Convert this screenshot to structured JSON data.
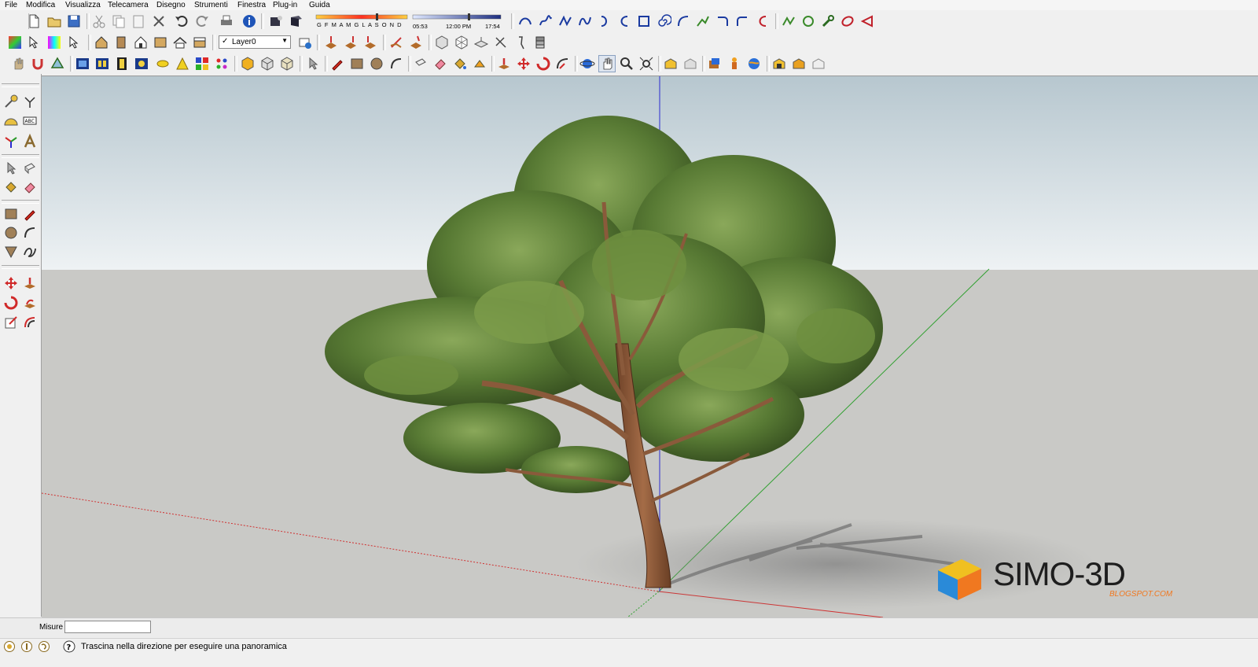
{
  "menu": [
    "File",
    "Modifica",
    "Visualizza",
    "Telecamera",
    "Disegno",
    "Strumenti",
    "Finestra",
    "Plug-in",
    "Guida"
  ],
  "shadow_timeline": {
    "months": "G F M A M G L A S O N D",
    "sunrise": "05:53",
    "noon": "12:00 PM",
    "sunset": "17:54"
  },
  "layer": {
    "current": "Layer0"
  },
  "icons": {
    "row1": [
      "new-file-icon",
      "open-file-icon",
      "save-icon",
      "cut-icon",
      "copy-icon",
      "paste-icon",
      "erase-icon",
      "undo-icon",
      "redo-icon",
      "print-icon",
      "model-info-icon",
      "shadow-settings-icon",
      "shadow-toggle-icon"
    ],
    "row2": [
      "materials-icon",
      "select-icon",
      "colour-icon",
      "cursor-icon",
      "house-icon",
      "door-icon",
      "home-icon",
      "front-icon",
      "roof-icon",
      "back-icon",
      "layer-manager-icon",
      "sandbox-icon",
      "sandbox-2-icon",
      "sandbox-3-icon",
      "sandbox-4-icon",
      "sandbox-5-icon",
      "sandbox-6-icon",
      "sandbox-7-icon",
      "sandbox-8-icon",
      "section-icon"
    ],
    "row3": [
      "hand-icon",
      "magnet-icon",
      "extend-icon",
      "film-1-icon",
      "film-2-icon",
      "film-3-icon",
      "film-4-icon",
      "lamp-icon",
      "cone-icon",
      "colour-grid-icon",
      "palette-icon",
      "box-1-icon",
      "box-2-icon",
      "box-3-icon",
      "select-arrow-icon",
      "pencil-icon",
      "rectangle-icon",
      "circle-icon",
      "arc-icon",
      "eraser-icon",
      "paint-bucket-icon",
      "push-pull-icon",
      "move-icon",
      "rotate-icon",
      "follow-me-icon",
      "orbit-icon",
      "pan-icon",
      "zoom-icon",
      "zoom-extents-icon",
      "warehouse-1-icon",
      "warehouse-2-icon",
      "share-icon",
      "person-icon",
      "globe-icon",
      "component-icon",
      "component-2-icon",
      "component-3-icon"
    ],
    "curves": [
      "curve-1-icon",
      "curve-2-icon",
      "curve-3-icon",
      "curve-4-icon",
      "curve-5-icon",
      "curve-6-icon",
      "square-icon",
      "spiral-icon",
      "arc-2-icon",
      "curve-7-icon",
      "curve-8-icon",
      "curve-9-icon",
      "curve-10-icon",
      "curve-11-icon",
      "curve-12-icon",
      "wrench-icon",
      "ellipse-icon",
      "teardrop-icon"
    ],
    "palette": [
      "tape-measure-icon",
      "axes-icon",
      "protractor-icon",
      "text-icon",
      "axis-tool-icon",
      "3d-text-icon",
      "select-tool-icon",
      "component-tool-icon",
      "paint-tool-icon",
      "eraser-tool-icon",
      "rectangle-tool-icon",
      "line-tool-icon",
      "circle-tool-icon",
      "arc-tool-icon",
      "polygon-tool-icon",
      "freehand-tool-icon",
      "move-tool-icon",
      "push-pull-tool-icon",
      "rotate-tool-icon",
      "follow-me-tool-icon",
      "scale-tool-icon",
      "offset-tool-icon"
    ]
  },
  "watermark": {
    "brand": "SIMO-3D",
    "sub": "BLOGSPOT.COM"
  },
  "measure": {
    "label": "Misure",
    "value": ""
  },
  "status": {
    "text": "Trascina nella direzione per eseguire una panoramica"
  },
  "colors": {
    "sky_top": "#b7c7cf",
    "sky_bottom": "#eef2f4",
    "ground": "#c9c9c6",
    "trunk": "#8a5a3b",
    "foliage": "#5e7d3a",
    "axis_red": "#d03030",
    "axis_green": "#30a030",
    "axis_blue": "#2a2ad0"
  }
}
